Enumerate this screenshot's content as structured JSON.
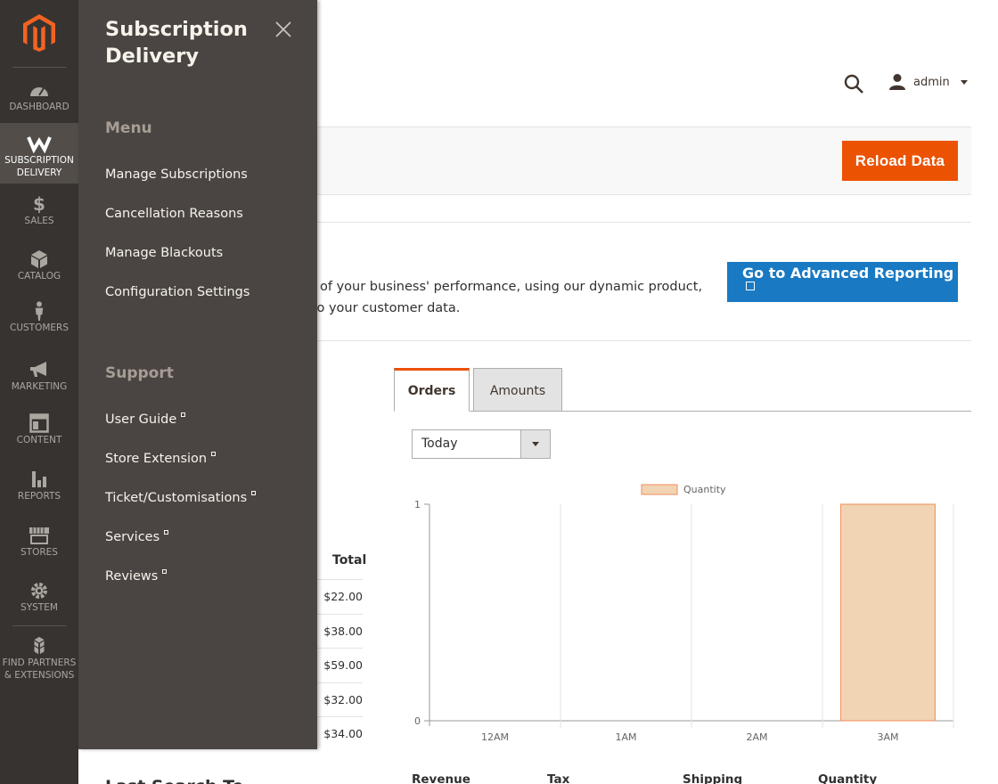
{
  "nav": {
    "items": [
      {
        "label": "Dashboard",
        "icon": "dashboard-icon"
      },
      {
        "label": "Subscription Delivery",
        "icon": "subscription-icon",
        "active": true
      },
      {
        "label": "Sales",
        "icon": "dollar-icon"
      },
      {
        "label": "Catalog",
        "icon": "cube-icon"
      },
      {
        "label": "Customers",
        "icon": "person-icon"
      },
      {
        "label": "Marketing",
        "icon": "megaphone-icon"
      },
      {
        "label": "Content",
        "icon": "layout-icon"
      },
      {
        "label": "Reports",
        "icon": "bar-chart-icon"
      },
      {
        "label": "Stores",
        "icon": "store-icon"
      },
      {
        "label": "System",
        "icon": "gear-icon"
      },
      {
        "label": "Find Partners & Extensions",
        "icon": "boxes-icon"
      }
    ]
  },
  "header": {
    "user_name": "admin"
  },
  "toolbar": {
    "reload_label": "Reload Data"
  },
  "advanced": {
    "text_line1": "nd of your business' performance, using our dynamic product,",
    "text_line2": "d to your customer data.",
    "button_label": "Go to Advanced Reporting"
  },
  "tabs": {
    "orders": "Orders",
    "amounts": "Amounts"
  },
  "period": {
    "selected": "Today"
  },
  "totals_table": {
    "header": "Total",
    "values": [
      "$22.00",
      "$38.00",
      "$59.00",
      "$32.00",
      "$34.00"
    ]
  },
  "chart_data": {
    "type": "bar",
    "categories": [
      "12AM",
      "1AM",
      "2AM",
      "3AM"
    ],
    "series": [
      {
        "name": "Quantity",
        "values": [
          0,
          0,
          0,
          1
        ]
      }
    ],
    "ylim": [
      0,
      1
    ],
    "yticks": [
      "0",
      "1"
    ],
    "legend": "top-center",
    "colors": {
      "fill": "#f1d4b3",
      "stroke": "#ef8e5a"
    }
  },
  "stats": {
    "revenue": "Revenue",
    "tax": "Tax",
    "shipping": "Shipping",
    "quantity": "Quantity"
  },
  "last_search": "Last Search Te",
  "flyout": {
    "title": "Subscription Delivery",
    "menu_heading": "Menu",
    "menu_items": [
      "Manage Subscriptions",
      "Cancellation Reasons",
      "Manage Blackouts",
      "Configuration Settings"
    ],
    "support_heading": "Support",
    "support_items": [
      "User Guide",
      "Store Extension",
      "Ticket/Customisations",
      "Services",
      "Reviews"
    ]
  },
  "colors": {
    "accent": "#eb5202",
    "primary": "#1979c3",
    "nav_bg": "#373330",
    "flyout_bg": "#4a4542"
  }
}
